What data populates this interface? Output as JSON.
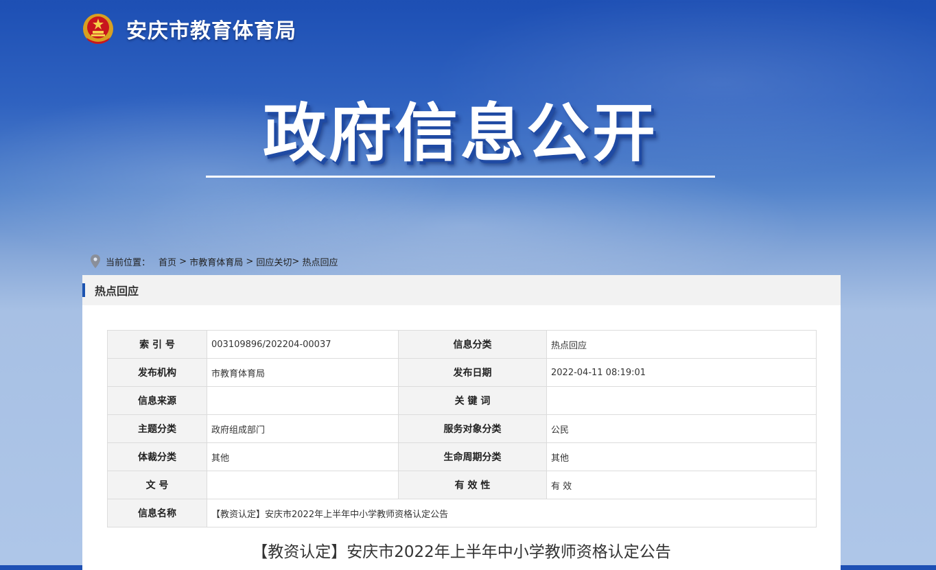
{
  "header": {
    "emblem_icon": "national-emblem-icon",
    "site_title": "安庆市教育体育局"
  },
  "banner": {
    "title": "政府信息公开"
  },
  "breadcrumb": {
    "icon": "location-pin-icon",
    "label": "当前位置：",
    "items": [
      "首页",
      " > ",
      "市教育体育局",
      " > ",
      "回应关切",
      "> ",
      "热点回应"
    ]
  },
  "panel": {
    "title": "热点回应"
  },
  "meta_table": {
    "rows": [
      {
        "label1": "索 引 号",
        "value1": "003109896/202204-00037",
        "label2": "信息分类",
        "value2": "热点回应"
      },
      {
        "label1": "发布机构",
        "value1": "市教育体育局",
        "label2": "发布日期",
        "value2": "2022-04-11 08:19:01"
      },
      {
        "label1": "信息来源",
        "value1": "",
        "label2": "关 键 词",
        "value2": ""
      },
      {
        "label1": "主题分类",
        "value1": "政府组成部门",
        "label2": "服务对象分类",
        "value2": "公民"
      },
      {
        "label1": "体裁分类",
        "value1": "其他",
        "label2": "生命周期分类",
        "value2": "其他"
      },
      {
        "label1": "文 号",
        "value1": "",
        "label2": "有 效 性",
        "value2": "有 效"
      }
    ],
    "name_row": {
      "label": "信息名称",
      "value": "【教资认定】安庆市2022年上半年中小学教师资格认定公告"
    }
  },
  "article": {
    "title": "【教资认定】安庆市2022年上半年中小学教师资格认定公告"
  },
  "colors": {
    "accent": "#1c53b0",
    "label_bg": "#f3f3f3",
    "border": "#dcdcdc"
  }
}
